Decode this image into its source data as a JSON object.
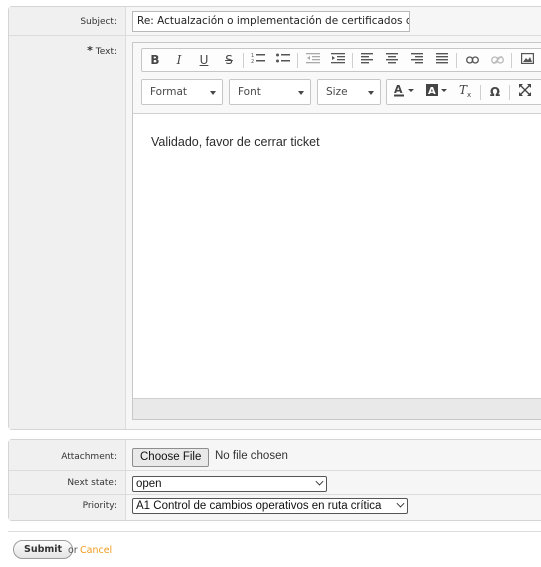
{
  "form": {
    "subject_label": "Subject:",
    "subject_value": "Re: Actualzación o implementación de certificados de se",
    "text_label": "Text:",
    "required_mark": "*",
    "editor": {
      "format_label": "Format",
      "font_label": "Font",
      "size_label": "Size",
      "content": "Validado, favor de cerrar ticket",
      "buttons": {
        "bold": "B",
        "italic": "I",
        "underline": "U",
        "strike": "S",
        "special_char": "Ω"
      }
    },
    "attachment_label": "Attachment:",
    "choose_file": "Choose File",
    "no_file": "No file chosen",
    "next_state_label": "Next state:",
    "next_state_value": "open",
    "priority_label": "Priority:",
    "priority_value": "A1 Control de cambios operativos en ruta crítica"
  },
  "actions": {
    "submit": "Submit",
    "or": "or",
    "cancel": "Cancel"
  },
  "icons": [
    "ordered-list-icon",
    "unordered-list-icon",
    "outdent-icon",
    "indent-icon",
    "align-left-icon",
    "align-center-icon",
    "align-right-icon",
    "justify-icon",
    "link-icon",
    "unlink-icon",
    "image-icon",
    "text-color-icon",
    "bg-color-icon",
    "remove-format-icon",
    "maximize-icon"
  ]
}
